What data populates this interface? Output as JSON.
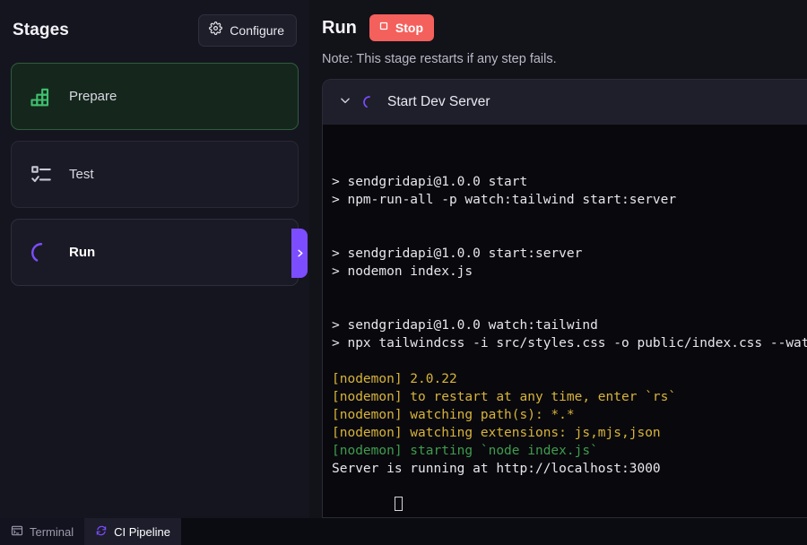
{
  "stages_panel": {
    "title": "Stages",
    "configure_label": "Configure",
    "configure_icon": "gear-icon",
    "stages": [
      {
        "label": "Prepare",
        "icon": "stairs-bar-icon",
        "state": "done",
        "accent": "#3fbf6f"
      },
      {
        "label": "Test",
        "icon": "checklist-icon",
        "state": "pending",
        "accent": "#c9c9d6"
      },
      {
        "label": "Run",
        "icon": "spinner-icon",
        "state": "running",
        "accent": "#7c4dff"
      }
    ],
    "run_tab_icon": "chevron-right-icon"
  },
  "run_panel": {
    "title": "Run",
    "stop_label": "Stop",
    "stop_icon": "stop-square-icon",
    "note": "Note: This stage restarts if any step fails.",
    "step": {
      "collapse_icon": "chevron-down-icon",
      "status_icon": "spinner-icon",
      "title": "Start Dev Server"
    },
    "terminal_lines": [
      {
        "text": "> sendgridapi@1.0.0 start",
        "color": "white"
      },
      {
        "text": "> npm-run-all -p watch:tailwind start:server",
        "color": "white"
      },
      {
        "text": "",
        "color": "blank"
      },
      {
        "text": "",
        "color": "blank"
      },
      {
        "text": "> sendgridapi@1.0.0 start:server",
        "color": "white"
      },
      {
        "text": "> nodemon index.js",
        "color": "white"
      },
      {
        "text": "",
        "color": "blank"
      },
      {
        "text": "",
        "color": "blank"
      },
      {
        "text": "> sendgridapi@1.0.0 watch:tailwind",
        "color": "white"
      },
      {
        "text": "> npx tailwindcss -i src/styles.css -o public/index.css --watch",
        "color": "white"
      },
      {
        "text": "",
        "color": "blank"
      },
      {
        "text": "[nodemon] 2.0.22",
        "color": "yellow"
      },
      {
        "text": "[nodemon] to restart at any time, enter `rs`",
        "color": "yellow"
      },
      {
        "text": "[nodemon] watching path(s): *.*",
        "color": "yellow"
      },
      {
        "text": "[nodemon] watching extensions: js,mjs,json",
        "color": "yellow"
      },
      {
        "text": "[nodemon] starting `node index.js`",
        "color": "green"
      },
      {
        "text": "Server is running at http://localhost:3000",
        "color": "white"
      }
    ],
    "cursor": "block-cursor"
  },
  "tabbar": {
    "tabs": [
      {
        "label": "Terminal",
        "icon": "terminal-window-icon",
        "active": false
      },
      {
        "label": "CI Pipeline",
        "icon": "refresh-cycle-icon",
        "active": true
      }
    ]
  },
  "colors": {
    "accent_purple": "#7c4dff",
    "accent_green": "#3fbf6f",
    "stop_red": "#f4605c",
    "terminal_yellow": "#d8b33a",
    "terminal_green": "#3f9c4d",
    "panel_bg": "#1b1b27",
    "terminal_bg": "#09090d"
  }
}
